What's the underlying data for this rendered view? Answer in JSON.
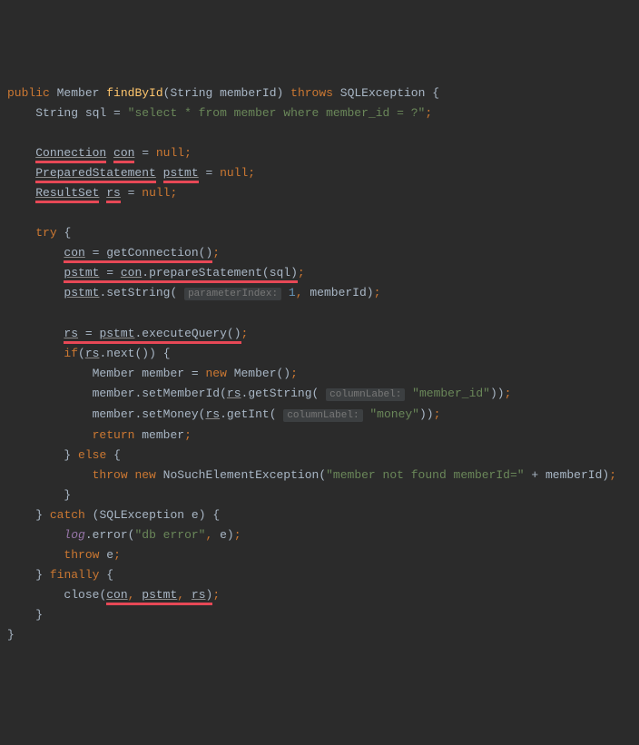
{
  "tokens": {
    "kw_public": "public",
    "type_member": "Member",
    "method_findById": "findById",
    "type_string": "String",
    "param_memberId": "memberId",
    "kw_throws": "throws",
    "type_sqlexception": "SQLException",
    "brace_open": "{",
    "brace_close": "}",
    "var_sql": "sql",
    "str_select": "\"select * from member where member_id = ?\"",
    "type_connection": "Connection",
    "var_con": "con",
    "kw_null": "null",
    "type_prepared": "PreparedStatement",
    "var_pstmt": "pstmt",
    "type_resultset": "ResultSet",
    "var_rs": "rs",
    "kw_try": "try",
    "call_getConnection": "getConnection",
    "call_prepareStatement": "prepareStatement",
    "call_setString": "setString",
    "hint_paramIndex": "parameterIndex:",
    "num_1": "1",
    "call_executeQuery": "executeQuery",
    "kw_if": "if",
    "call_next": "next",
    "var_member": "member",
    "kw_new": "new",
    "call_setMemberId": "setMemberId",
    "call_getString": "getString",
    "hint_columnLabel": "columnLabel:",
    "str_member_id": "\"member_id\"",
    "call_setMoney": "setMoney",
    "call_getInt": "getInt",
    "str_money": "\"money\"",
    "kw_return": "return",
    "kw_else": "else",
    "kw_throw": "throw",
    "type_nosuch": "NoSuchElementException",
    "str_notfound": "\"member not found memberId=\"",
    "kw_catch": "catch",
    "var_e": "e",
    "var_log": "log",
    "call_error": "error",
    "str_dberror": "\"db error\"",
    "kw_finally": "finally",
    "call_close": "close"
  }
}
